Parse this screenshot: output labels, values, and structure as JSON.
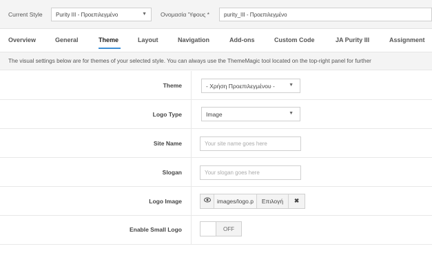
{
  "header": {
    "current_style_label": "Current Style",
    "current_style_value": "Purity III - Προεπιλεγμένο",
    "style_name_label": "Ονομασία 'Υφους *",
    "style_name_value": "purity_III - Προεπιλεγμένο"
  },
  "tabs": [
    {
      "label": "Overview"
    },
    {
      "label": "General"
    },
    {
      "label": "Theme"
    },
    {
      "label": "Layout"
    },
    {
      "label": "Navigation"
    },
    {
      "label": "Add-ons"
    },
    {
      "label": "Custom Code"
    },
    {
      "label": "JA Purity III"
    },
    {
      "label": "Assignment"
    }
  ],
  "active_tab": "Theme",
  "notice": "The visual settings below are for themes of your selected style. You can always use the ThemeMagic tool located on the top-right panel for further",
  "fields": {
    "theme": {
      "label": "Theme",
      "value": "- Χρήση Προεπιλεγμένου -"
    },
    "logo_type": {
      "label": "Logo Type",
      "value": "Image"
    },
    "site_name": {
      "label": "Site Name",
      "placeholder": "Your site name goes here"
    },
    "slogan": {
      "label": "Slogan",
      "placeholder": "Your slogan goes here"
    },
    "logo_image": {
      "label": "Logo Image",
      "path": "images/logo.p",
      "select_label": "Επιλογή"
    },
    "small_logo": {
      "label": "Enable Small Logo",
      "state": "OFF"
    }
  },
  "icons": {
    "preview": "eye-icon",
    "clear": "close-icon",
    "dropdown": "caret-down-icon"
  },
  "colors": {
    "accent": "#3b8fd6",
    "panel_bg": "#f4f4f4"
  }
}
